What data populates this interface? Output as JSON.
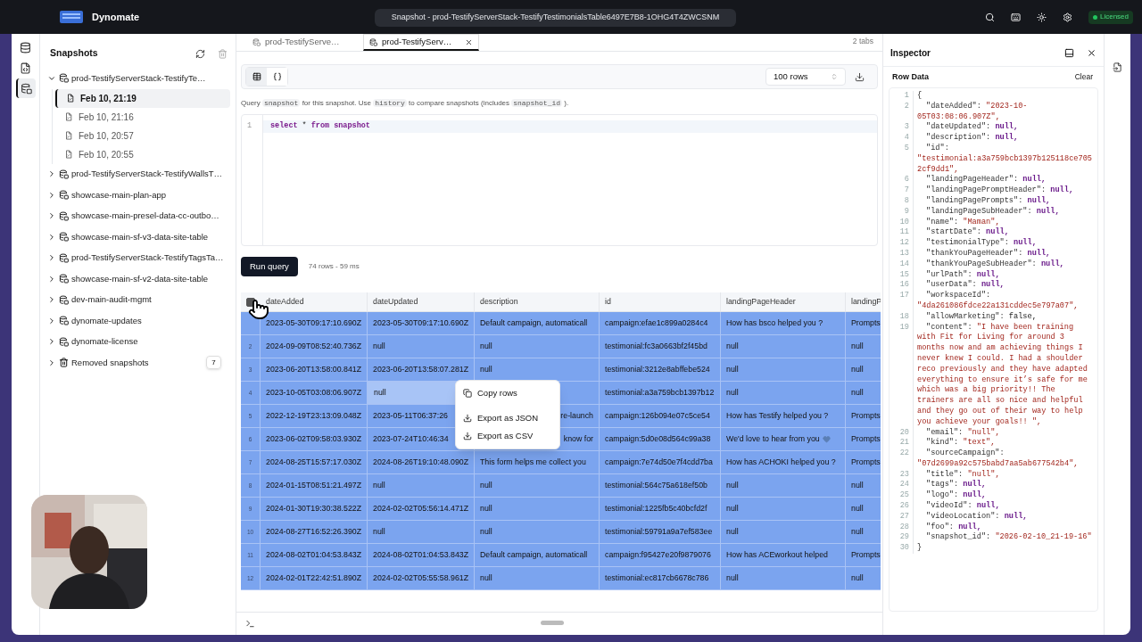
{
  "titlebar": {
    "app_name": "Dynomate",
    "title": "Snapshot - prod-TestifyServerStack-TestifyTestimonialsTable6497E7B8-1OHG4T4ZWCSNM",
    "license": "Licensed"
  },
  "rail": [
    {
      "kind": "database",
      "selected": false
    },
    {
      "kind": "file",
      "selected": false
    },
    {
      "kind": "snapshots",
      "selected": true
    }
  ],
  "sidebar": {
    "title": "Snapshots",
    "items": [
      {
        "label": "prod-TestifyServerStack-TestifyTe…",
        "kind": "table",
        "expanded": true,
        "children": [
          {
            "label": "Feb 10, 21:19",
            "selected": true
          },
          {
            "label": "Feb 10, 21:16",
            "selected": false
          },
          {
            "label": "Feb 10, 20:57",
            "selected": false
          },
          {
            "label": "Feb 10, 20:55",
            "selected": false
          }
        ]
      },
      {
        "label": "prod-TestifyServerStack-TestifyWallsT…",
        "kind": "table",
        "expanded": false
      },
      {
        "label": "showcase-main-plan-app",
        "kind": "table",
        "expanded": false
      },
      {
        "label": "showcase-main-presel-data-cc-outbo…",
        "kind": "table",
        "expanded": false
      },
      {
        "label": "showcase-main-sf-v3-data-site-table",
        "kind": "table",
        "expanded": false
      },
      {
        "label": "prod-TestifyServerStack-TestifyTagsTa…",
        "kind": "table",
        "expanded": false
      },
      {
        "label": "showcase-main-sf-v2-data-site-table",
        "kind": "table",
        "expanded": false
      },
      {
        "label": "dev-main-audit-mgmt",
        "kind": "table",
        "expanded": false
      },
      {
        "label": "dynomate-updates",
        "kind": "table",
        "expanded": false
      },
      {
        "label": "dynomate-license",
        "kind": "table",
        "expanded": false
      },
      {
        "label": "Removed snapshots",
        "kind": "trash",
        "expanded": false,
        "count": "7"
      }
    ]
  },
  "tabs": [
    {
      "label": "prod-TestifyServe…",
      "selected": false,
      "closable": false
    },
    {
      "label": "prod-TestifyServ…",
      "selected": true,
      "closable": true
    }
  ],
  "tab_count": "2 tabs",
  "toolbar": {
    "views": [
      {
        "kind": "table",
        "selected": true
      },
      {
        "kind": "json",
        "selected": false
      }
    ],
    "row_limit": "100 rows"
  },
  "hint": [
    {
      "kind": "text",
      "text": "Query "
    },
    {
      "kind": "code",
      "text": "snapshot"
    },
    {
      "kind": "text",
      "text": " for this snapshot. Use "
    },
    {
      "kind": "code",
      "text": "history"
    },
    {
      "kind": "text",
      "text": " to compare snapshots (includes "
    },
    {
      "kind": "code",
      "text": "snapshot_id"
    },
    {
      "kind": "text",
      "text": " )."
    }
  ],
  "editor": {
    "lines": [
      {
        "n": "1",
        "tokens": [
          {
            "kind": "keyword",
            "text": "select"
          },
          {
            "kind": "operator",
            "text": "*"
          },
          {
            "kind": "keyword",
            "text": "from"
          },
          {
            "kind": "name",
            "text": "snapshot"
          }
        ]
      }
    ]
  },
  "run_button": "Run query",
  "run_status": "74 rows - 59 ms",
  "table": {
    "all_checked": true,
    "columns": [
      "dateAdded",
      "dateUpdated",
      "description",
      "id",
      "landingPageHeader",
      "landingP"
    ],
    "rows": [
      {
        "selected": true,
        "cells": [
          "2023-05-30T09:17:10.690Z",
          "2023-05-30T09:17:10.690Z",
          "Default campaign, automaticall",
          "campaign:efae1c899a0284c4",
          "How has bsco helped you ?",
          "Prompts"
        ]
      },
      {
        "number": "2",
        "selected": true,
        "cells": [
          "2024-09-09T08:52:40.736Z",
          "null",
          "null",
          "testimonial:fc3a0663bf2f45bd",
          "null",
          "null"
        ]
      },
      {
        "number": "3",
        "selected": true,
        "cells": [
          "2023-06-20T13:58:00.841Z",
          "2023-06-20T13:58:07.281Z",
          "null",
          "testimonial:3212e8abffebe524",
          "null",
          "null"
        ]
      },
      {
        "number": "4",
        "selected": true,
        "cells": [
          "2023-10-05T03:08:06.907Z",
          {
            "text": "null",
            "focused": true
          },
          null,
          "testimonial:a3a759bcb1397b12",
          "null",
          "null"
        ]
      },
      {
        "number": "5",
        "selected": true,
        "cells": [
          "2022-12-19T23:13:09.048Z",
          "2023-05-11T06:37:26",
          {
            "text": "re-launch",
            "kind": "tail"
          },
          "campaign:126b094e07c5ce54",
          "How has Testify helped you ?",
          "Prompts"
        ]
      },
      {
        "number": "6",
        "selected": true,
        "cells": [
          "2023-06-02T09:58:03.930Z",
          "2023-07-24T10:46:34",
          {
            "text": "know for",
            "kind": "tail"
          },
          "campaign:5d0e08d564c99a38",
          {
            "text": "We'd love to hear from you",
            "kind": "heart"
          },
          "Prompts"
        ]
      },
      {
        "number": "7",
        "selected": true,
        "cells": [
          "2024-08-25T15:57:17.030Z",
          "2024-08-26T19:10:48.090Z",
          "This form helps me collect you",
          "campaign:7e74d50e7f4cdd7ba",
          "How has ACHOKI helped you ?",
          "Prompts"
        ]
      },
      {
        "number": "8",
        "selected": true,
        "cells": [
          "2024-01-15T08:51:21.497Z",
          "null",
          "null",
          "testimonial:564c75a618ef50b",
          "null",
          "null"
        ]
      },
      {
        "number": "9",
        "selected": true,
        "cells": [
          "2024-01-30T19:30:38.522Z",
          "2024-02-02T05:56:14.471Z",
          "null",
          "testimonial:1225fb5c40bcfd2f",
          "null",
          "null"
        ]
      },
      {
        "number": "10",
        "selected": true,
        "cells": [
          "2024-08-27T16:52:26.390Z",
          "null",
          "null",
          "testimonial:59791a9a7ef583ee",
          "null",
          "null"
        ]
      },
      {
        "number": "11",
        "selected": true,
        "cells": [
          "2024-08-02T01:04:53.843Z",
          "2024-08-02T01:04:53.843Z",
          "Default campaign, automaticall",
          "campaign:f95427e20f9879076",
          "How has ACEworkout helped",
          "Prompts"
        ]
      },
      {
        "number": "12",
        "selected": true,
        "cells": [
          "2024-02-01T22:42:51.890Z",
          "2024-02-02T05:55:58.961Z",
          "null",
          "testimonial:ec817cb6678c786",
          "null",
          "null"
        ]
      }
    ]
  },
  "context_menu": {
    "items": [
      {
        "kind": "copy",
        "label": "Copy rows"
      },
      {
        "kind": "download",
        "label": "Export as JSON"
      },
      {
        "kind": "download",
        "label": "Export as CSV"
      }
    ]
  },
  "inspector": {
    "title": "Inspector",
    "section": "Row Data",
    "clear": "Clear",
    "lines": [
      {
        "n": "1",
        "punct": "{"
      },
      {
        "n": "2",
        "key": "\"dateAdded\":",
        "value": "\"2023-10-",
        "kind": "string",
        "wrap": [
          "05T03:08:06.907Z\","
        ]
      },
      {
        "n": "3",
        "key": "\"dateUpdated\":",
        "value": "null,",
        "kind": "null"
      },
      {
        "n": "4",
        "key": "\"description\":",
        "value": "null,",
        "kind": "null"
      },
      {
        "n": "5",
        "key": "\"id\":",
        "kind": "string",
        "wrap": [
          "\"testimonial:a3a759bcb1397b125118ce705",
          "2cf9dd1\","
        ]
      },
      {
        "n": "6",
        "key": "\"landingPageHeader\":",
        "value": "null,",
        "kind": "null"
      },
      {
        "n": "7",
        "key": "\"landingPagePromptHeader\":",
        "value": "null,",
        "kind": "null"
      },
      {
        "n": "8",
        "key": "\"landingPagePrompts\":",
        "value": "null,",
        "kind": "null"
      },
      {
        "n": "9",
        "key": "\"landingPageSubHeader\":",
        "value": "null,",
        "kind": "null"
      },
      {
        "n": "10",
        "key": "\"name\":",
        "value": "\"Maman\",",
        "kind": "string"
      },
      {
        "n": "11",
        "key": "\"startDate\":",
        "value": "null,",
        "kind": "null"
      },
      {
        "n": "12",
        "key": "\"testimonialType\":",
        "value": "null,",
        "kind": "null"
      },
      {
        "n": "13",
        "key": "\"thankYouPageHeader\":",
        "value": "null,",
        "kind": "null"
      },
      {
        "n": "14",
        "key": "\"thankYouPageSubHeader\":",
        "value": "null,",
        "kind": "null"
      },
      {
        "n": "15",
        "key": "\"urlPath\":",
        "value": "null,",
        "kind": "null"
      },
      {
        "n": "16",
        "key": "\"userData\":",
        "value": "null,",
        "kind": "null"
      },
      {
        "n": "17",
        "key": "\"workspaceId\":",
        "kind": "string",
        "wrap": [
          "\"4da261086fdce22a131cddec5e797a07\","
        ]
      },
      {
        "n": "18",
        "key": "\"allowMarketing\":",
        "value": "false,",
        "kind": "bool"
      },
      {
        "n": "19",
        "key": "\"content\":",
        "value": "\"I have been training",
        "kind": "string",
        "wrap": [
          "with Fit for Living for around 3",
          "months now and am achieving things I",
          "never knew I could. I had a shoulder",
          "reco previously and they have adapted",
          "everything to ensure it’s safe for me",
          "which was a big priority!! The",
          "trainers are all so nice and helpful",
          "and they go out of their way to help",
          "you achieve your goals!! \","
        ]
      },
      {
        "n": "20",
        "key": "\"email\":",
        "value": "\"null\",",
        "kind": "string"
      },
      {
        "n": "21",
        "key": "\"kind\":",
        "value": "\"text\",",
        "kind": "string"
      },
      {
        "n": "22",
        "key": "\"sourceCampaign\":",
        "kind": "string",
        "wrap": [
          "\"07d2699a92c575babd7aa5ab677542b4\","
        ]
      },
      {
        "n": "23",
        "key": "\"title\":",
        "value": "\"null\",",
        "kind": "string"
      },
      {
        "n": "24",
        "key": "\"tags\":",
        "value": "null,",
        "kind": "null"
      },
      {
        "n": "25",
        "key": "\"logo\":",
        "value": "null,",
        "kind": "null"
      },
      {
        "n": "26",
        "key": "\"videoId\":",
        "value": "null,",
        "kind": "null"
      },
      {
        "n": "27",
        "key": "\"videoLocation\":",
        "value": "null,",
        "kind": "null"
      },
      {
        "n": "28",
        "key": "\"foo\":",
        "value": "null,",
        "kind": "null"
      },
      {
        "n": "29",
        "key": "\"snapshot_id\":",
        "value": "\"2026-02-10_21-19-16\"",
        "kind": "string"
      },
      {
        "n": "30",
        "punct": "}"
      }
    ]
  }
}
